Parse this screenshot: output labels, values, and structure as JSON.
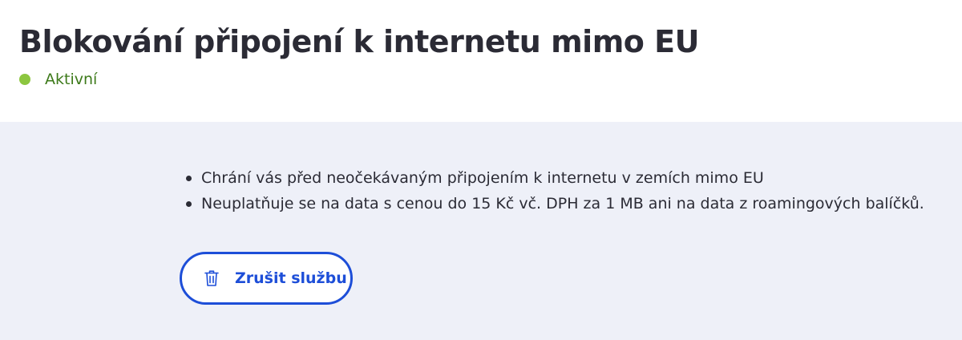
{
  "header": {
    "title": "Blokování připojení k internetu mimo EU",
    "status": {
      "label": "Aktivní",
      "color": "#8cc63f"
    }
  },
  "main": {
    "bullets": [
      "Chrání vás před neočekávaným připojením k internetu v zemích mimo EU",
      "Neuplatňuje se na data s cenou do 15 Kč vč. DPH za 1 MB ani na data z roamingových balíčků."
    ],
    "cancel_button": {
      "label": "Zrušit službu",
      "icon": "trash-icon"
    }
  },
  "colors": {
    "accent": "#1d4ed8",
    "background": "#eef0f8",
    "status_text": "#3d7a1a"
  }
}
